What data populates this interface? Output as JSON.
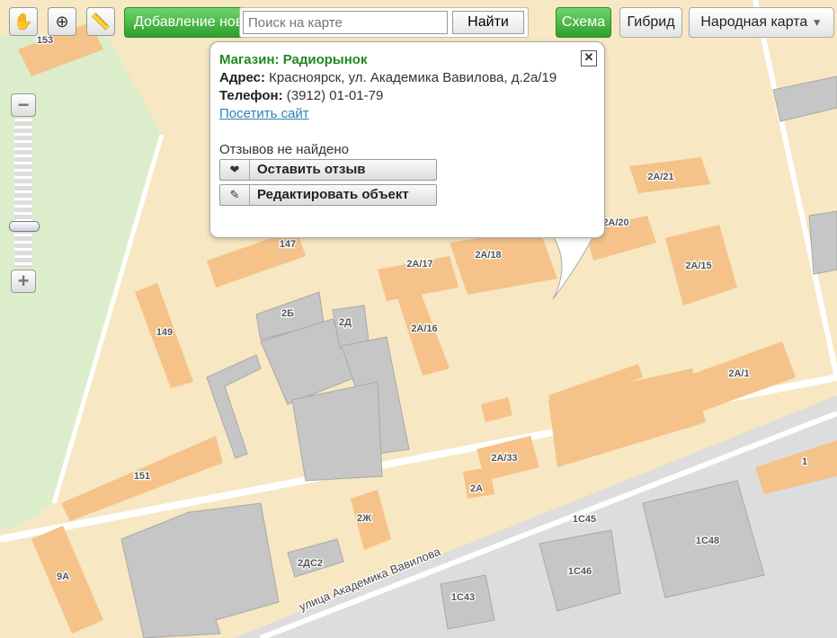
{
  "toolbar": {
    "hand_icon": "hand-icon",
    "zoom_rect_icon": "zoom-rect-icon",
    "ruler_icon": "ruler-icon",
    "add_label": "Добавление нового",
    "search_placeholder": "Поиск на карте",
    "search_value": "",
    "find_label": "Найти",
    "scheme_label": "Схема",
    "hybrid_label": "Гибрид",
    "people_label": "Народная карта"
  },
  "zoom": {
    "plus": "+",
    "minus": "−",
    "level_fraction": 0.08
  },
  "balloon": {
    "title": "Магазин: Радиорынок",
    "address_label": "Адрес:",
    "address": "Красноярск, ул. Академика Вавилова, д.2а/19",
    "phone_label": "Телефон:",
    "phone": "(3912) 01-01-79",
    "site_link": "Посетить сайт",
    "reviews": "Отзывов не найдено",
    "review_button": "Оставить отзыв",
    "edit_button": "Редактировать объект"
  },
  "map": {
    "street": "улица Академика Вавилова",
    "labels": [
      "153",
      "147",
      "149",
      "2Б",
      "2Д",
      "2А/17",
      "2А/18",
      "2А/16",
      "2А/21",
      "2А/20",
      "2А/15",
      "2А/1",
      "151",
      "2А/33",
      "2А",
      "2Ж",
      "2ДС2",
      "9А",
      "1С45",
      "1С46",
      "1С48",
      "1С43",
      "1"
    ]
  },
  "colors": {
    "background": "#f7e7c2",
    "building": "#f5c28a",
    "gray_building": "#c6c6c6",
    "road": "#dcdcdc",
    "park": "#dcedcc",
    "accent_green": "#2e9e2c"
  }
}
